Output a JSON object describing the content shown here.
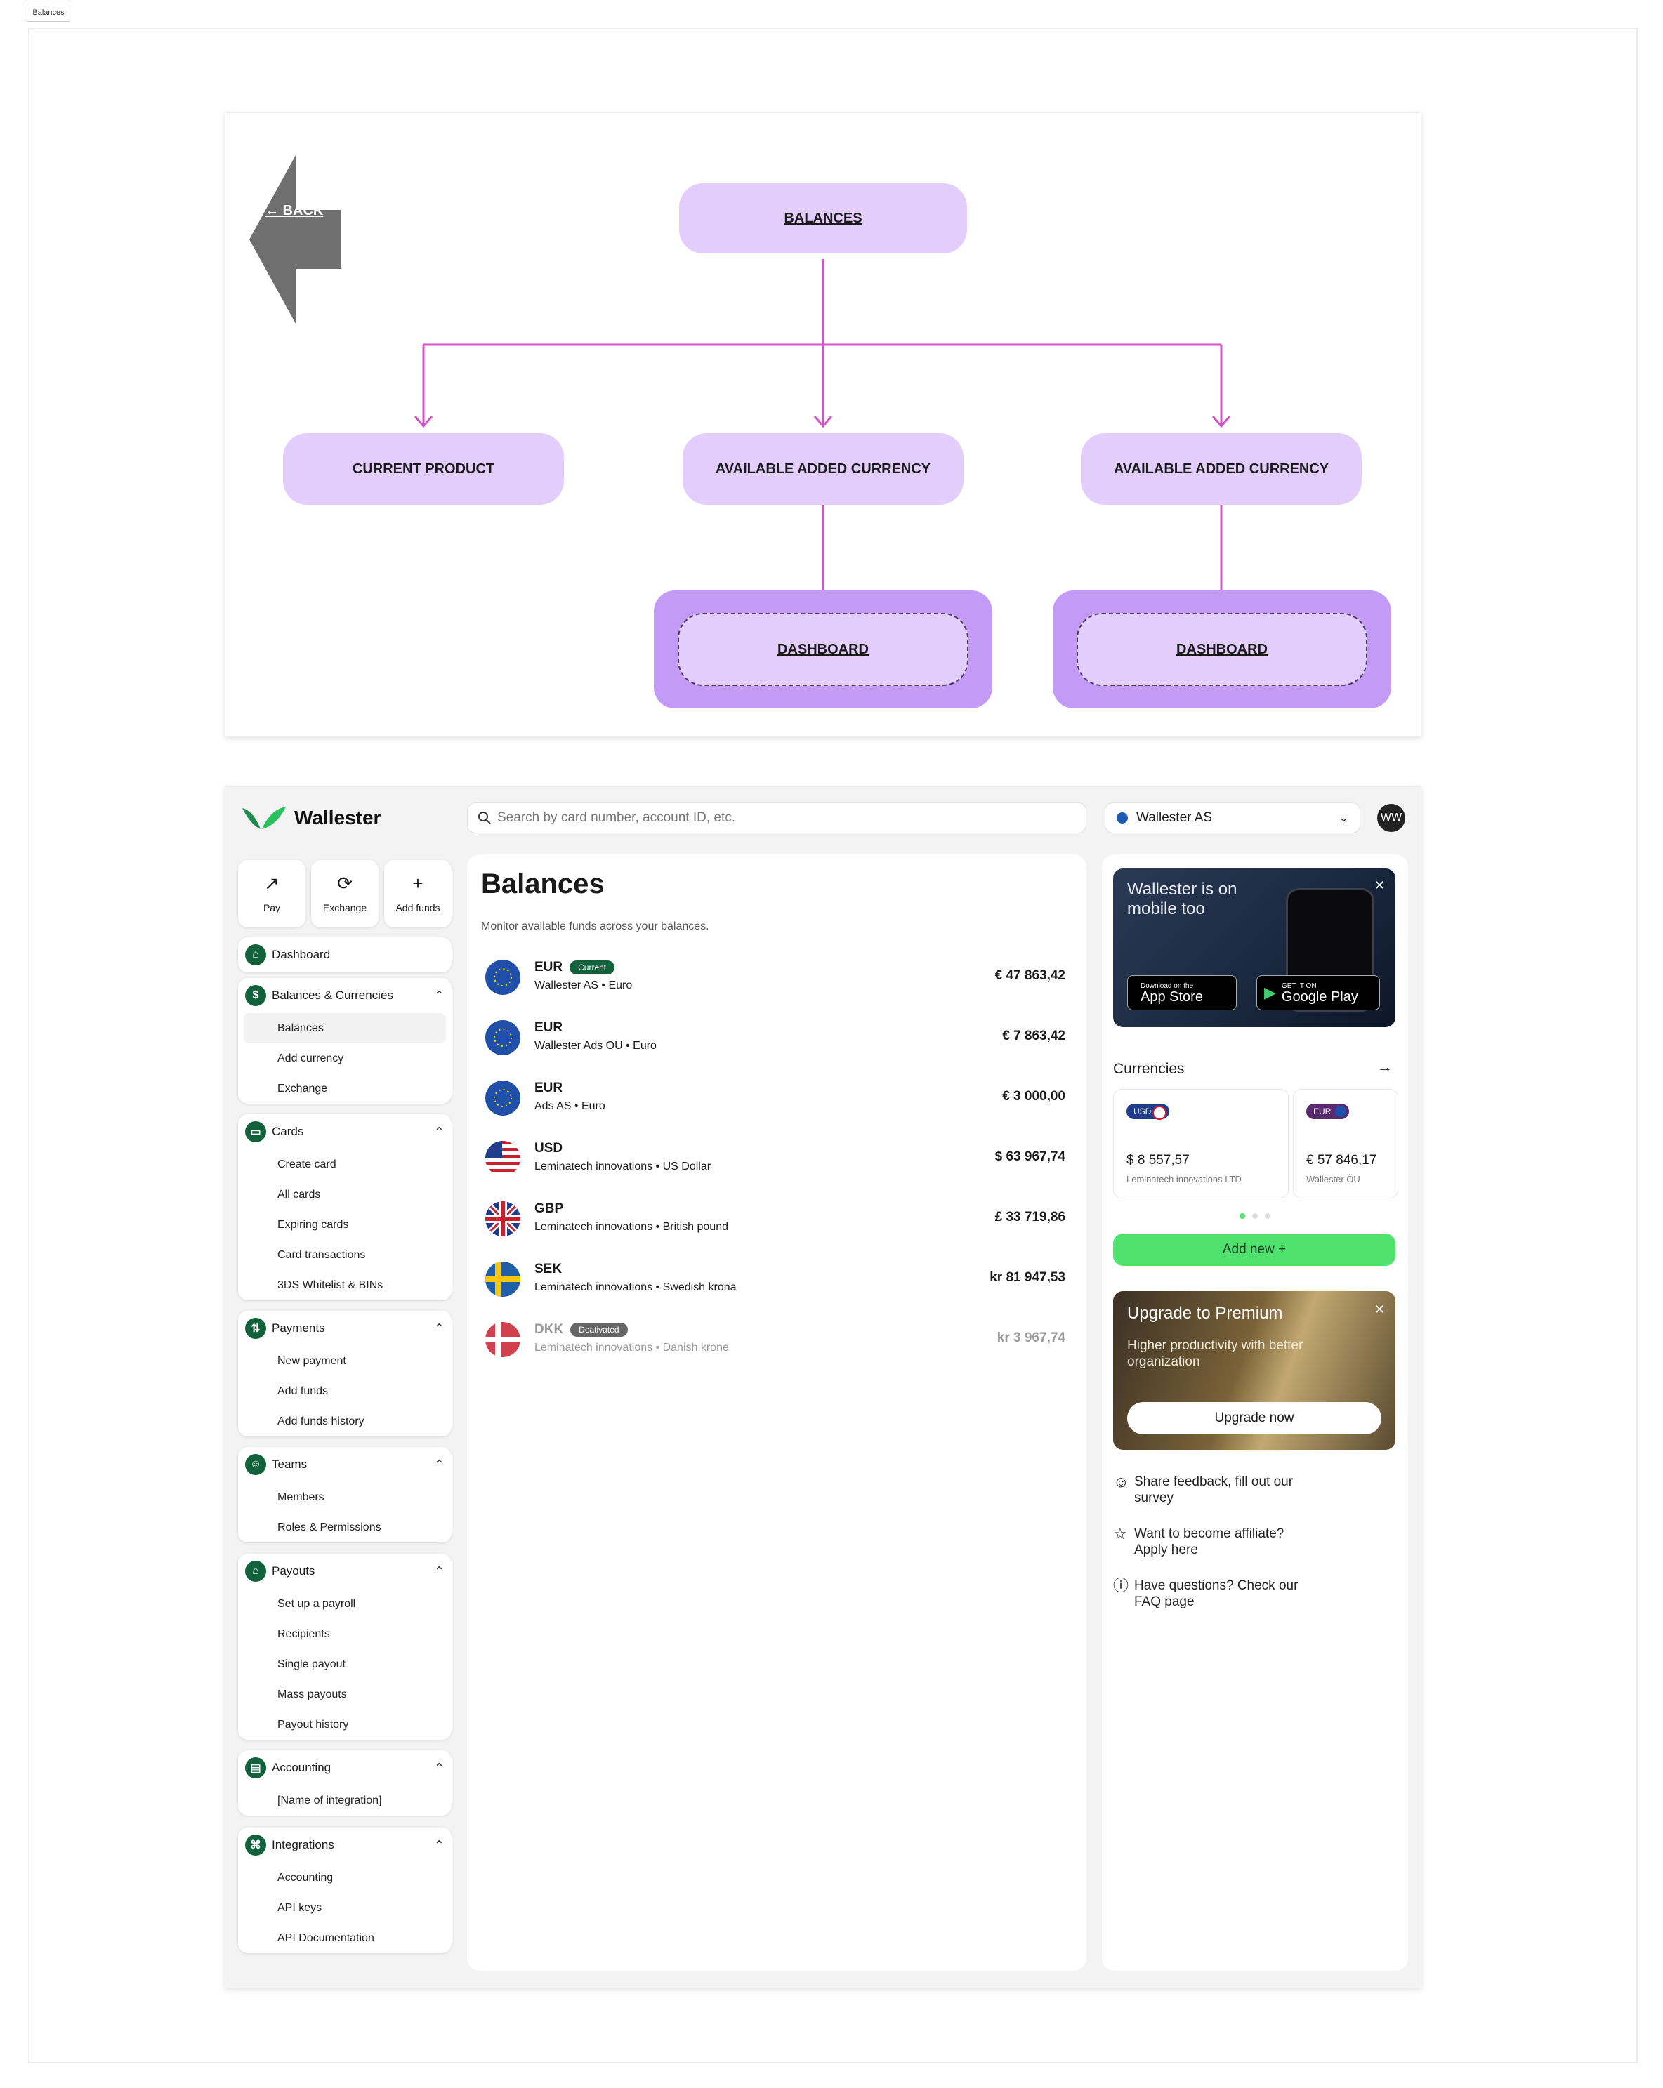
{
  "frame_label": "Balances",
  "flow": {
    "back_label": "← BACK",
    "root": "BALANCES",
    "children": [
      "CURRENT PRODUCT",
      "AVAILABLE ADDED CURRENCY",
      "AVAILABLE ADDED CURRENCY"
    ],
    "leaves": [
      "DASHBOARD",
      "DASHBOARD"
    ],
    "line_color": "#d552c9"
  },
  "app": {
    "brand": "Wallester",
    "search_placeholder": "Search by card number, account ID, etc.",
    "account": "Wallester AS",
    "avatar": "WW",
    "quick_actions": [
      {
        "label": "Pay",
        "icon": "arrow-up-right-icon"
      },
      {
        "label": "Exchange",
        "icon": "exchange-icon"
      },
      {
        "label": "Add funds",
        "icon": "plus-icon"
      }
    ],
    "nav": {
      "dashboard": "Dashboard",
      "balances_currencies": {
        "title": "Balances & Currencies",
        "items": [
          "Balances",
          "Add currency",
          "Exchange"
        ]
      },
      "cards": {
        "title": "Cards",
        "items": [
          "Create card",
          "All cards",
          "Expiring cards",
          "Card transactions",
          "3DS Whitelist & BINs"
        ]
      },
      "payments": {
        "title": "Payments",
        "items": [
          "New payment",
          "Add funds",
          "Add funds history"
        ]
      },
      "teams": {
        "title": "Teams",
        "items": [
          "Members",
          "Roles & Permissions"
        ]
      },
      "payouts": {
        "title": "Payouts",
        "items": [
          "Set up a payroll",
          "Recipients",
          "Single payout",
          "Mass payouts",
          "Payout history"
        ]
      },
      "accounting": {
        "title": "Accounting",
        "items": [
          "[Name of integration]"
        ]
      },
      "integrations": {
        "title": "Integrations",
        "items": [
          "Accounting",
          "API keys",
          "API Documentation"
        ]
      }
    },
    "main": {
      "title": "Balances",
      "subtitle": "Monitor available funds across your balances.",
      "rows": [
        {
          "code": "EUR",
          "badge": "Current",
          "name": "Wallester AS •  Euro",
          "amount": "€ 47 863,42"
        },
        {
          "code": "EUR",
          "badge": "",
          "name": "Wallester Ads OU •  Euro",
          "amount": "€ 7 863,42"
        },
        {
          "code": "EUR",
          "badge": "",
          "name": "Ads AS •  Euro",
          "amount": "€ 3 000,00"
        },
        {
          "code": "USD",
          "badge": "",
          "name": "Leminatech innovations • US Dollar",
          "amount": "$ 63 967,74"
        },
        {
          "code": "GBP",
          "badge": "",
          "name": "Leminatech innovations • British pound",
          "amount": "£ 33 719,86"
        },
        {
          "code": "SEK",
          "badge": "",
          "name": "Leminatech innovations • Swedish krona",
          "amount": "kr 81 947,53"
        },
        {
          "code": "DKK",
          "badge": "Deativated",
          "name": "Leminatech innovations • Danish krone",
          "amount": "kr 3 967,74"
        }
      ]
    },
    "right": {
      "promo_title": "Wallester is on mobile too",
      "appstore_small": "Download on the",
      "appstore_big": "App Store",
      "gplay_small": "GET IT ON",
      "gplay_big": "Google Play",
      "currencies_title": "Currencies",
      "currency_cards": [
        {
          "code": "USD",
          "amount": "$ 8 557,57",
          "entity": "Leminatech innovations LTD"
        },
        {
          "code": "EUR",
          "amount": "€ 57 846,17",
          "entity": "Wallester ÕU"
        }
      ],
      "add_new": "Add new  +",
      "upgrade_title": "Upgrade to Premium",
      "upgrade_sub": "Higher productivity with better organization",
      "upgrade_btn": "Upgrade now",
      "help": [
        {
          "icon": "feedback-icon",
          "text": "Share feedback, fill out our survey"
        },
        {
          "icon": "star-icon",
          "text": "Want to become affiliate? Apply here"
        },
        {
          "icon": "question-icon",
          "text": "Have questions? Check our FAQ page"
        }
      ]
    },
    "colors": {
      "brand_green": "#11613b",
      "accent_green": "#4fe36e",
      "flow_box": "#e3cdfb",
      "dashboard_box": "#c39bf6"
    }
  }
}
